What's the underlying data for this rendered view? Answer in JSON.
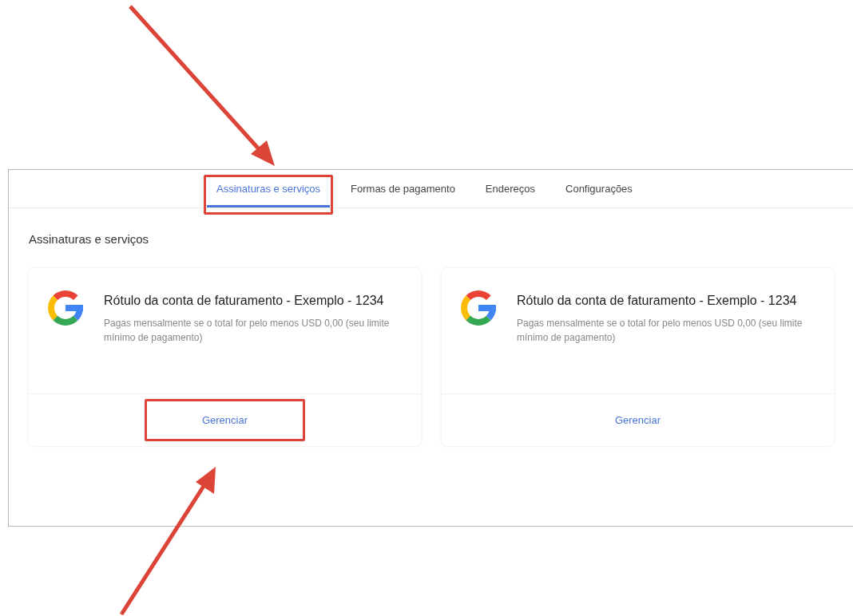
{
  "tabs": [
    {
      "label": "Assinaturas e serviços",
      "selected": true,
      "highlighted": true
    },
    {
      "label": "Formas de pagamento",
      "selected": false,
      "highlighted": false
    },
    {
      "label": "Endereços",
      "selected": false,
      "highlighted": false
    },
    {
      "label": "Configurações",
      "selected": false,
      "highlighted": false
    }
  ],
  "section_title": "Assinaturas e serviços",
  "cards": [
    {
      "title": "Rótulo da conta de faturamento - Exemplo - 1234",
      "description": "Pagas mensalmente se o total for pelo menos USD 0,00 (seu limite mínimo de pagamento)",
      "button": "Gerenciar",
      "highlighted": true
    },
    {
      "title": "Rótulo da conta de faturamento - Exemplo - 1234",
      "description": "Pagas mensalmente se o total for pelo menos USD 0,00 (seu limite mínimo de pagamento)",
      "button": "Gerenciar",
      "highlighted": false
    }
  ]
}
